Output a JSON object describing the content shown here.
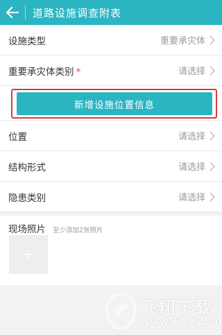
{
  "header": {
    "title": "道路设施调查附表",
    "back_icon": "arrow-left-icon",
    "color": "#2bb5c2"
  },
  "form": {
    "rows_top": [
      {
        "label": "设施类型",
        "value": "重要承灾体",
        "required": false
      },
      {
        "label": "重要承灾体类别",
        "value": "请选择",
        "required": true
      }
    ],
    "add_button_label": "新增设施位置信息",
    "rows_bottom": [
      {
        "label": "位置",
        "value": "请选择",
        "required": false
      },
      {
        "label": "结构形式",
        "value": "请选择",
        "required": false
      },
      {
        "label": "隐患类别",
        "value": "请选择",
        "required": false
      }
    ],
    "required_mark": "*"
  },
  "photos": {
    "title": "现场照片",
    "hint": "至少添加2张照片",
    "add_icon": "plus-icon"
  },
  "watermark": {
    "name": "飞翔下载",
    "url": "www.FXXZ.com"
  },
  "colors": {
    "accent": "#2bb5c2",
    "highlight": "#d93a3a",
    "required": "#e0403a"
  }
}
